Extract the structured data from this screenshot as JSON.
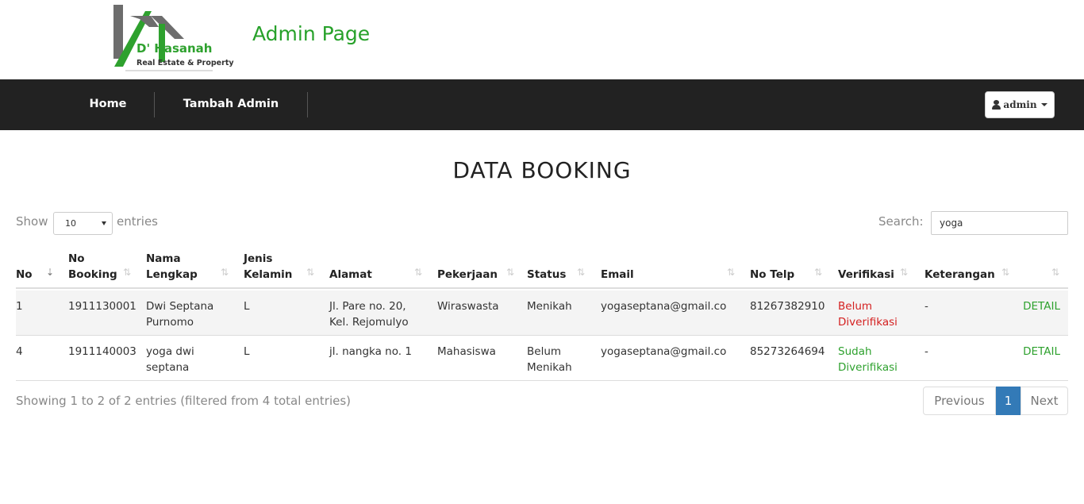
{
  "brand": {
    "name": "D' Hasanah",
    "tagline": "Real Estate & Property",
    "page_heading": "Admin Page",
    "green": "#2ea12e"
  },
  "navbar": {
    "home_label": "Home",
    "tambah_label": "Tambah Admin",
    "user_label": "admin",
    "user_icon": "user-icon",
    "background": "#222222"
  },
  "main": {
    "title": "DATA BOOKING",
    "show_label": "Show",
    "length_value": "10",
    "entries_label": "entries",
    "search_label": "Search:",
    "search_value": "yoga"
  },
  "table": {
    "headers": [
      "No",
      "No Booking",
      "Nama Lengkap",
      "Jenis Kelamin",
      "Alamat",
      "Pekerjaan",
      "Status",
      "Email",
      "No Telp",
      "Verifikasi",
      "Keterangan",
      ""
    ],
    "header_lines": [
      [
        "No"
      ],
      [
        "No",
        "Booking"
      ],
      [
        "Nama",
        "Lengkap"
      ],
      [
        "Jenis",
        "Kelamin"
      ],
      [
        "Alamat"
      ],
      [
        "Pekerjaan"
      ],
      [
        "Status"
      ],
      [
        "Email"
      ],
      [
        "No Telp"
      ],
      [
        "Verifikasi"
      ],
      [
        "Keterangan"
      ],
      [
        ""
      ]
    ],
    "rows": [
      {
        "no": "1",
        "no_booking": "1911130001",
        "nama": [
          "Dwi Septana",
          "Purnomo"
        ],
        "jenis_kelamin": "L",
        "alamat": [
          "Jl. Pare no. 20,",
          "Kel. Rejomulyo"
        ],
        "pekerjaan": "Wiraswasta",
        "status": [
          "Menikah"
        ],
        "email": "yogaseptana@gmail.co",
        "no_telp": "81267382910",
        "verifikasi": [
          "Belum",
          "Diverifikasi"
        ],
        "verifikasi_state": "unverified",
        "keterangan": "-",
        "action": "DETAIL"
      },
      {
        "no": "4",
        "no_booking": "1911140003",
        "nama": [
          "yoga dwi",
          "septana"
        ],
        "jenis_kelamin": "L",
        "alamat": [
          "jl. nangka no. 1"
        ],
        "pekerjaan": "Mahasiswa",
        "status": [
          "Belum",
          "Menikah"
        ],
        "email": "yogaseptana@gmail.co",
        "no_telp": "85273264694",
        "verifikasi": [
          "Sudah",
          "Diverifikasi"
        ],
        "verifikasi_state": "verified",
        "keterangan": "-",
        "action": "DETAIL"
      }
    ]
  },
  "footer": {
    "info": "Showing 1 to 2 of 2 entries (filtered from 4 total entries)",
    "prev_label": "Previous",
    "current_page": "1",
    "next_label": "Next"
  },
  "colors": {
    "unverified": "#d42020",
    "verified": "#2ea12e",
    "pagination_active": "#337ab7"
  }
}
